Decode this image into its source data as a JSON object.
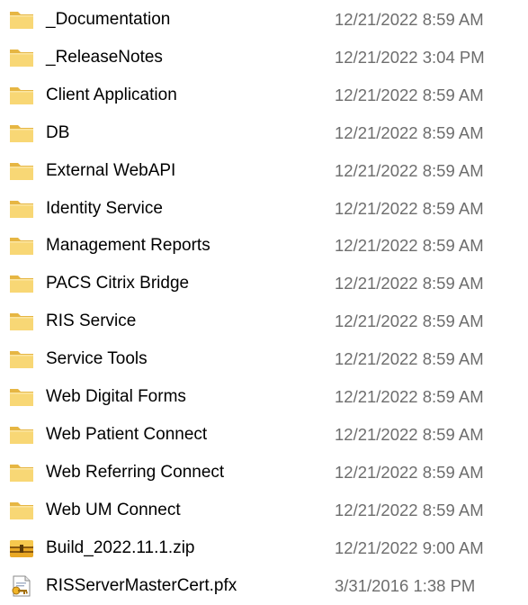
{
  "files": [
    {
      "name": "_Documentation",
      "date": "12/21/2022 8:59 AM",
      "icon": "folder-icon"
    },
    {
      "name": "_ReleaseNotes",
      "date": "12/21/2022 3:04 PM",
      "icon": "folder-icon"
    },
    {
      "name": "Client Application",
      "date": "12/21/2022 8:59 AM",
      "icon": "folder-icon"
    },
    {
      "name": "DB",
      "date": "12/21/2022 8:59 AM",
      "icon": "folder-icon"
    },
    {
      "name": "External WebAPI",
      "date": "12/21/2022 8:59 AM",
      "icon": "folder-icon"
    },
    {
      "name": "Identity Service",
      "date": "12/21/2022 8:59 AM",
      "icon": "folder-icon"
    },
    {
      "name": "Management Reports",
      "date": "12/21/2022 8:59 AM",
      "icon": "folder-icon"
    },
    {
      "name": "PACS Citrix Bridge",
      "date": "12/21/2022 8:59 AM",
      "icon": "folder-icon"
    },
    {
      "name": "RIS Service",
      "date": "12/21/2022 8:59 AM",
      "icon": "folder-icon"
    },
    {
      "name": "Service Tools",
      "date": "12/21/2022 8:59 AM",
      "icon": "folder-icon"
    },
    {
      "name": "Web Digital Forms",
      "date": "12/21/2022 8:59 AM",
      "icon": "folder-icon"
    },
    {
      "name": "Web Patient Connect",
      "date": "12/21/2022 8:59 AM",
      "icon": "folder-icon"
    },
    {
      "name": "Web Referring Connect",
      "date": "12/21/2022 8:59 AM",
      "icon": "folder-icon"
    },
    {
      "name": "Web UM Connect",
      "date": "12/21/2022 8:59 AM",
      "icon": "folder-icon"
    },
    {
      "name": "Build_2022.11.1.zip",
      "date": "12/21/2022 9:00 AM",
      "icon": "zip-archive-icon"
    },
    {
      "name": "RISServerMasterCert.pfx",
      "date": "3/31/2016 1:38 PM",
      "icon": "certificate-file-icon"
    }
  ],
  "colors": {
    "folder_body": "#f8d775",
    "folder_back": "#e6b643",
    "zip_body": "#e9a825",
    "date_text": "#6d6d6d",
    "name_text": "#000000"
  }
}
